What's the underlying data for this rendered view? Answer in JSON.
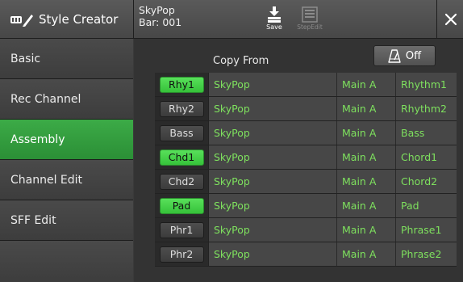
{
  "header": {
    "app_title": "Style Creator",
    "style_name": "SkyPop",
    "bar": "Bar: 001",
    "save_label": "Save",
    "stepedit_label": "StepEdit",
    "close_symbol": "✕"
  },
  "sidebar": {
    "items": [
      {
        "label": "Basic",
        "active": false
      },
      {
        "label": "Rec Channel",
        "active": false
      },
      {
        "label": "Assembly",
        "active": true
      },
      {
        "label": "Channel Edit",
        "active": false
      },
      {
        "label": "SFF Edit",
        "active": false
      }
    ]
  },
  "main": {
    "copy_from_label": "Copy From",
    "metronome": {
      "icon": "metronome-icon",
      "state": "Off"
    },
    "rows": [
      {
        "part": "Rhy1",
        "on": true,
        "style": "SkyPop",
        "section": "Main A",
        "channel": "Rhythm1"
      },
      {
        "part": "Rhy2",
        "on": false,
        "style": "SkyPop",
        "section": "Main A",
        "channel": "Rhythm2"
      },
      {
        "part": "Bass",
        "on": false,
        "style": "SkyPop",
        "section": "Main A",
        "channel": "Bass"
      },
      {
        "part": "Chd1",
        "on": true,
        "style": "SkyPop",
        "section": "Main A",
        "channel": "Chord1"
      },
      {
        "part": "Chd2",
        "on": false,
        "style": "SkyPop",
        "section": "Main A",
        "channel": "Chord2"
      },
      {
        "part": "Pad",
        "on": true,
        "style": "SkyPop",
        "section": "Main A",
        "channel": "Pad"
      },
      {
        "part": "Phr1",
        "on": false,
        "style": "SkyPop",
        "section": "Main A",
        "channel": "Phrase1"
      },
      {
        "part": "Phr2",
        "on": false,
        "style": "SkyPop",
        "section": "Main A",
        "channel": "Phrase2"
      }
    ]
  },
  "colors": {
    "accent": "#3cab47",
    "value_text": "#7ee05e",
    "part_on": "#45d048"
  }
}
